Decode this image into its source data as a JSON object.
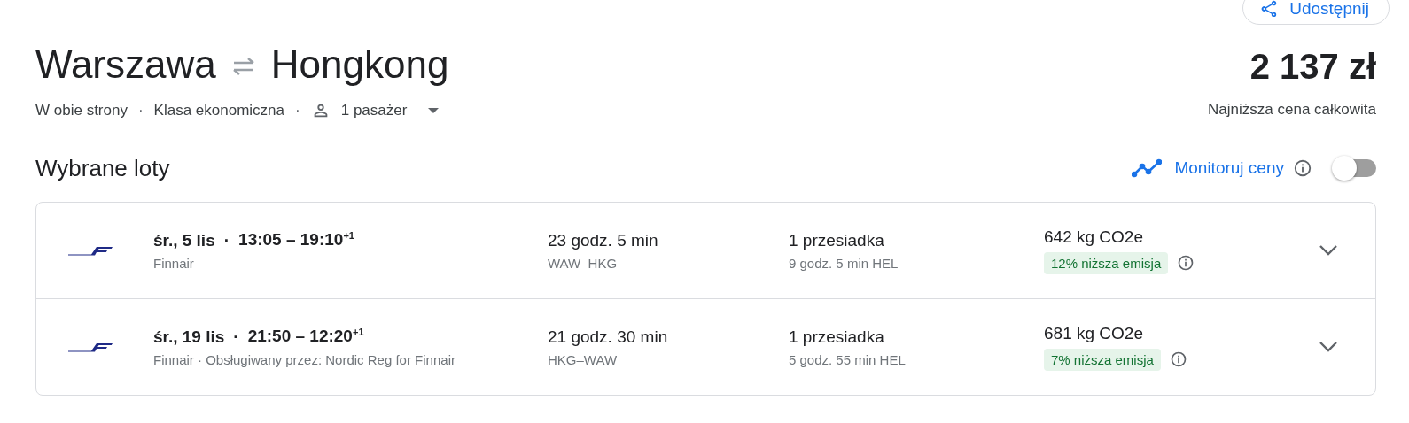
{
  "share_button": {
    "label": "Udostępnij"
  },
  "route": {
    "origin": "Warszawa",
    "destination": "Hongkong"
  },
  "option_separator": "·",
  "flight_separator": "·",
  "trip_options": [
    {
      "kind": "text",
      "label": "W obie strony"
    },
    {
      "kind": "text",
      "label": "Klasa ekonomiczna"
    },
    {
      "kind": "passengers",
      "label": "1 pasażer"
    }
  ],
  "price": {
    "amount": "2 137 zł",
    "note": "Najniższa cena całkowita"
  },
  "section_title": "Wybrane loty",
  "price_tracking": {
    "label": "Monitoruj ceny",
    "on": false
  },
  "flights": [
    {
      "date": "śr., 5 lis",
      "times": "13:05 – 19:10$^{+1}$",
      "airline": "Finnair",
      "duration": "23 godz. 5 min",
      "route": "WAW–HKG",
      "stops": "1 przesiadka",
      "layover": "9 godz. 5 min HEL",
      "emissions": "642 kg CO2e",
      "emission_badge": "12% niższa emisja",
      "expanded": false
    },
    {
      "date": "śr., 19 lis",
      "times": "21:50 – 12:20$^{+1}$",
      "airline": "Finnair · Obsługiwany przez: Nordic Reg for Finnair",
      "duration": "21 godz. 30 min",
      "route": "HKG–WAW",
      "stops": "1 przesiadka",
      "layover": "5 godz. 55 min HEL",
      "emissions": "681 kg CO2e",
      "emission_badge": "7% niższa emisja",
      "expanded": false
    }
  ]
}
